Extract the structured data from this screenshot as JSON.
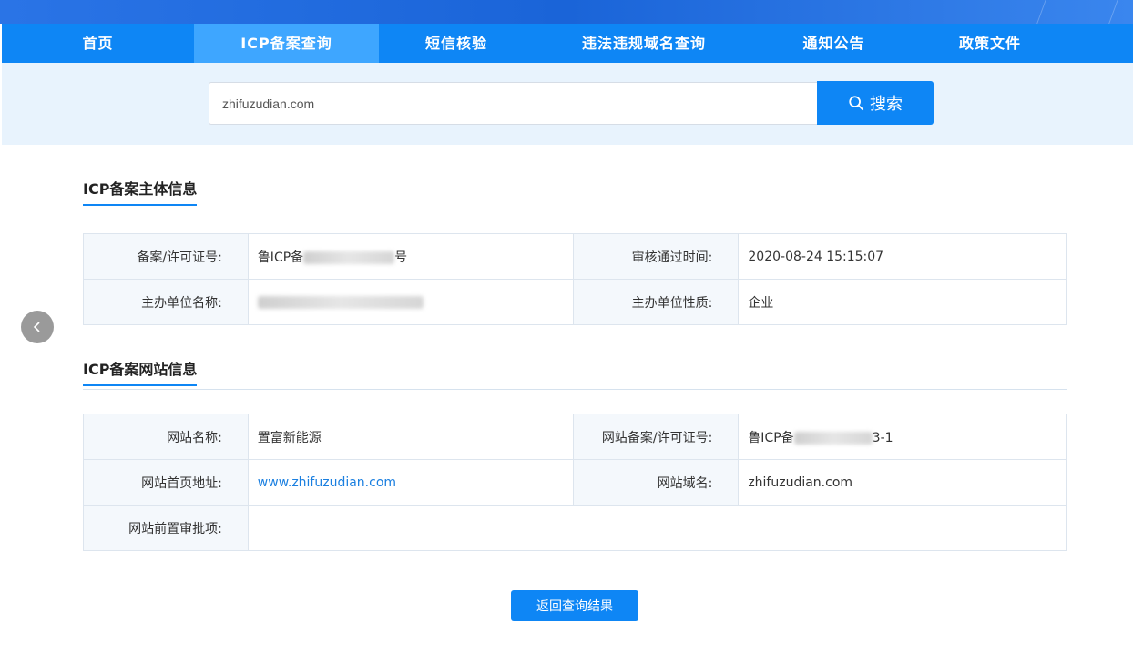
{
  "nav": {
    "items": [
      {
        "label": "首页"
      },
      {
        "label": "ICP备案查询"
      },
      {
        "label": "短信核验"
      },
      {
        "label": "违法违规域名查询"
      },
      {
        "label": "通知公告"
      },
      {
        "label": "政策文件"
      }
    ],
    "active_index": 1
  },
  "search": {
    "value": "zhifuzudian.com",
    "button_label": "搜索"
  },
  "subject_section": {
    "title": "ICP备案主体信息",
    "rows": [
      {
        "label1": "备案/许可证号:",
        "value1_prefix": "鲁ICP备",
        "value1_suffix": "号",
        "label2": "审核通过时间:",
        "value2": "2020-08-24 15:15:07"
      },
      {
        "label1": "主办单位名称:",
        "value1_prefix": "",
        "value1_suffix": "",
        "label2": "主办单位性质:",
        "value2": "企业"
      }
    ]
  },
  "website_section": {
    "title": "ICP备案网站信息",
    "rows": [
      {
        "label1": "网站名称:",
        "value1": "置富新能源",
        "label2": "网站备案/许可证号:",
        "value2_prefix": "鲁ICP备",
        "value2_suffix": "3-1"
      },
      {
        "label1": "网站首页地址:",
        "value1": "www.zhifuzudian.com",
        "label2": "网站域名:",
        "value2": "zhifuzudian.com"
      },
      {
        "label1": "网站前置审批项:",
        "value1": ""
      }
    ]
  },
  "back_button_label": "返回查询结果",
  "colors": {
    "primary": "#0e86f5",
    "nav_active": "#3ea6ff",
    "search_band": "#e8f3fd",
    "link": "#1a7fe0"
  }
}
